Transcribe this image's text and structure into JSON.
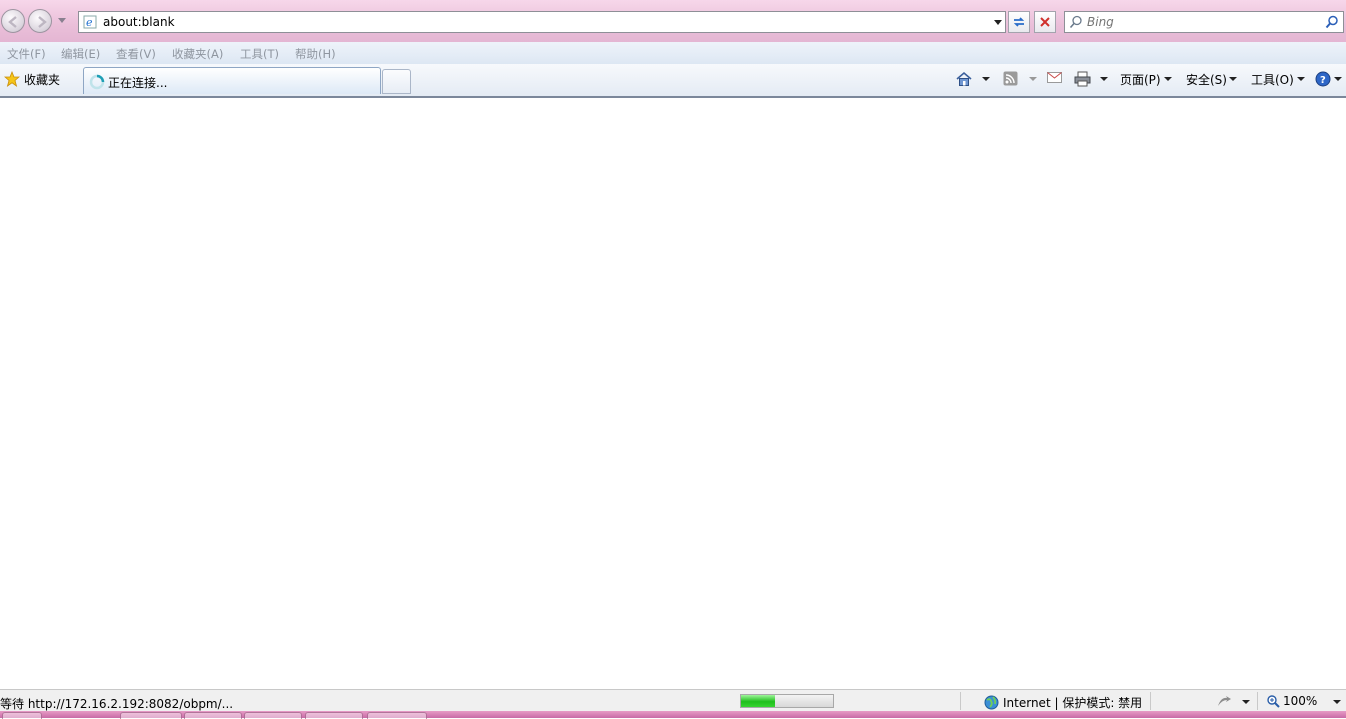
{
  "address_bar": {
    "url": "about:blank"
  },
  "search": {
    "placeholder": "Bing"
  },
  "menu": {
    "items": [
      "文件(F)",
      "编辑(E)",
      "查看(V)",
      "收藏夹(A)",
      "工具(T)",
      "帮助(H)"
    ]
  },
  "favorites": {
    "label": "收藏夹"
  },
  "tabs": [
    {
      "label": "正在连接..."
    }
  ],
  "command_bar": {
    "page_label": "页面(P)",
    "safety_label": "安全(S)",
    "tools_label": "工具(O)"
  },
  "status": {
    "text": "等待 http://172.16.2.192:8082/obpm/...",
    "progress": 0.37,
    "zone": "Internet | 保护模式: 禁用",
    "zoom": "100%"
  },
  "colors": {
    "chrome_pink": "#eabfd9",
    "progress_green": "#1fbf1c",
    "menu_text_disabled": "#8f96a0"
  },
  "icons": {
    "back": "back-arrow-icon",
    "forward": "forward-arrow-icon",
    "refresh": "refresh-icon",
    "stop": "stop-x-icon",
    "search": "magnifier-icon",
    "favorites": "star-icon",
    "loading": "spinner-icon",
    "home": "home-icon",
    "feeds": "rss-icon",
    "mail": "mail-icon",
    "print": "printer-icon",
    "help": "help-icon",
    "zone": "globe-icon",
    "zoom": "zoom-icon"
  }
}
